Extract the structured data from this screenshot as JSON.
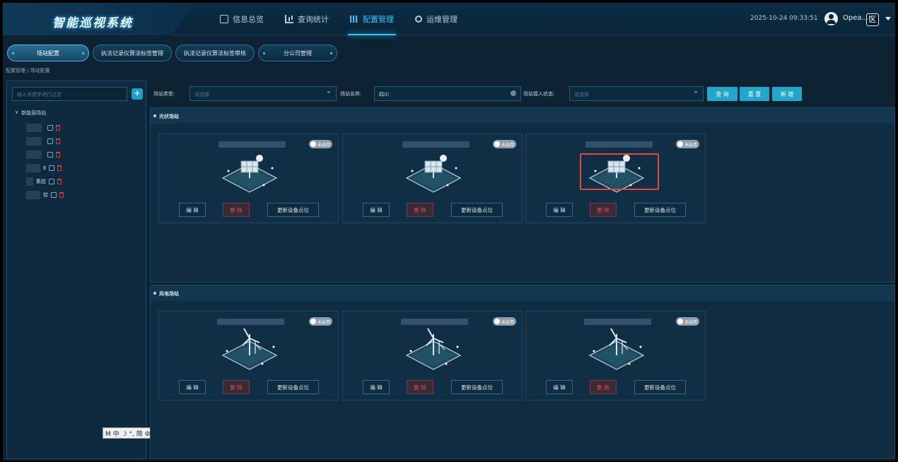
{
  "app": {
    "title": "智能巡视系统"
  },
  "header": {
    "nav": [
      {
        "label": "信息总览",
        "icon": "doc-icon"
      },
      {
        "label": "查询统计",
        "icon": "chart-icon"
      },
      {
        "label": "配置管理",
        "icon": "equalizer-icon",
        "active": true
      },
      {
        "label": "运维管理",
        "icon": "gear-icon"
      }
    ],
    "datetime": "2025-10-24 09:33:51",
    "username": "Opea...n",
    "close_label": "区"
  },
  "tabs": [
    {
      "label": "场站配置",
      "active": true
    },
    {
      "label": "执法记录仪算法标签管理"
    },
    {
      "label": "执法记录仪算法标签审核"
    },
    {
      "label": "分公司管理"
    }
  ],
  "breadcrumb": "配置管理 / 场站配置",
  "sidebar": {
    "search_placeholder": "输入关键字进行过滤",
    "add_label": "+",
    "tree_root": "新能源场站",
    "items": [
      {
        "suffix": ""
      },
      {
        "suffix": ""
      },
      {
        "suffix": ""
      },
      {
        "suffix": "E"
      },
      {
        "suffix": "集控"
      },
      {
        "suffix": "控"
      }
    ]
  },
  "filter": {
    "type_label": "场站类型:",
    "type_placeholder": "请选择",
    "name_label": "场站名称:",
    "name_value": "四川",
    "status_label": "场站接入状态:",
    "status_placeholder": "请选择",
    "search_btn": "查 询",
    "reset_btn": "重 置",
    "add_btn": "新 增"
  },
  "sections": [
    {
      "title": "光伏场站",
      "kind": "solar",
      "cards": [
        {
          "status": "未启用",
          "edit": "编 辑",
          "delete": "删 除",
          "update": "更新设备点位"
        },
        {
          "status": "未启用",
          "edit": "编 辑",
          "delete": "删 除",
          "update": "更新设备点位"
        },
        {
          "status": "未启用",
          "edit": "编 辑",
          "delete": "删 除",
          "update": "更新设备点位"
        }
      ]
    },
    {
      "title": "风电场站",
      "kind": "wind",
      "cards": [
        {
          "status": "未启用",
          "edit": "编 辑",
          "delete": "删 除",
          "update": "更新设备点位"
        },
        {
          "status": "未启用",
          "edit": "编 辑",
          "delete": "删 除",
          "update": "更新设备点位"
        },
        {
          "status": "未启用",
          "edit": "编 辑",
          "delete": "删 除",
          "update": "更新设备点位"
        }
      ]
    }
  ],
  "ime": {
    "text": "M 中 ☽ °, 简 ⚙ ⋮"
  },
  "colors": {
    "accent": "#2ec7ff",
    "button": "#22a6c9",
    "danger": "#e05050",
    "background": "#0d2233"
  }
}
